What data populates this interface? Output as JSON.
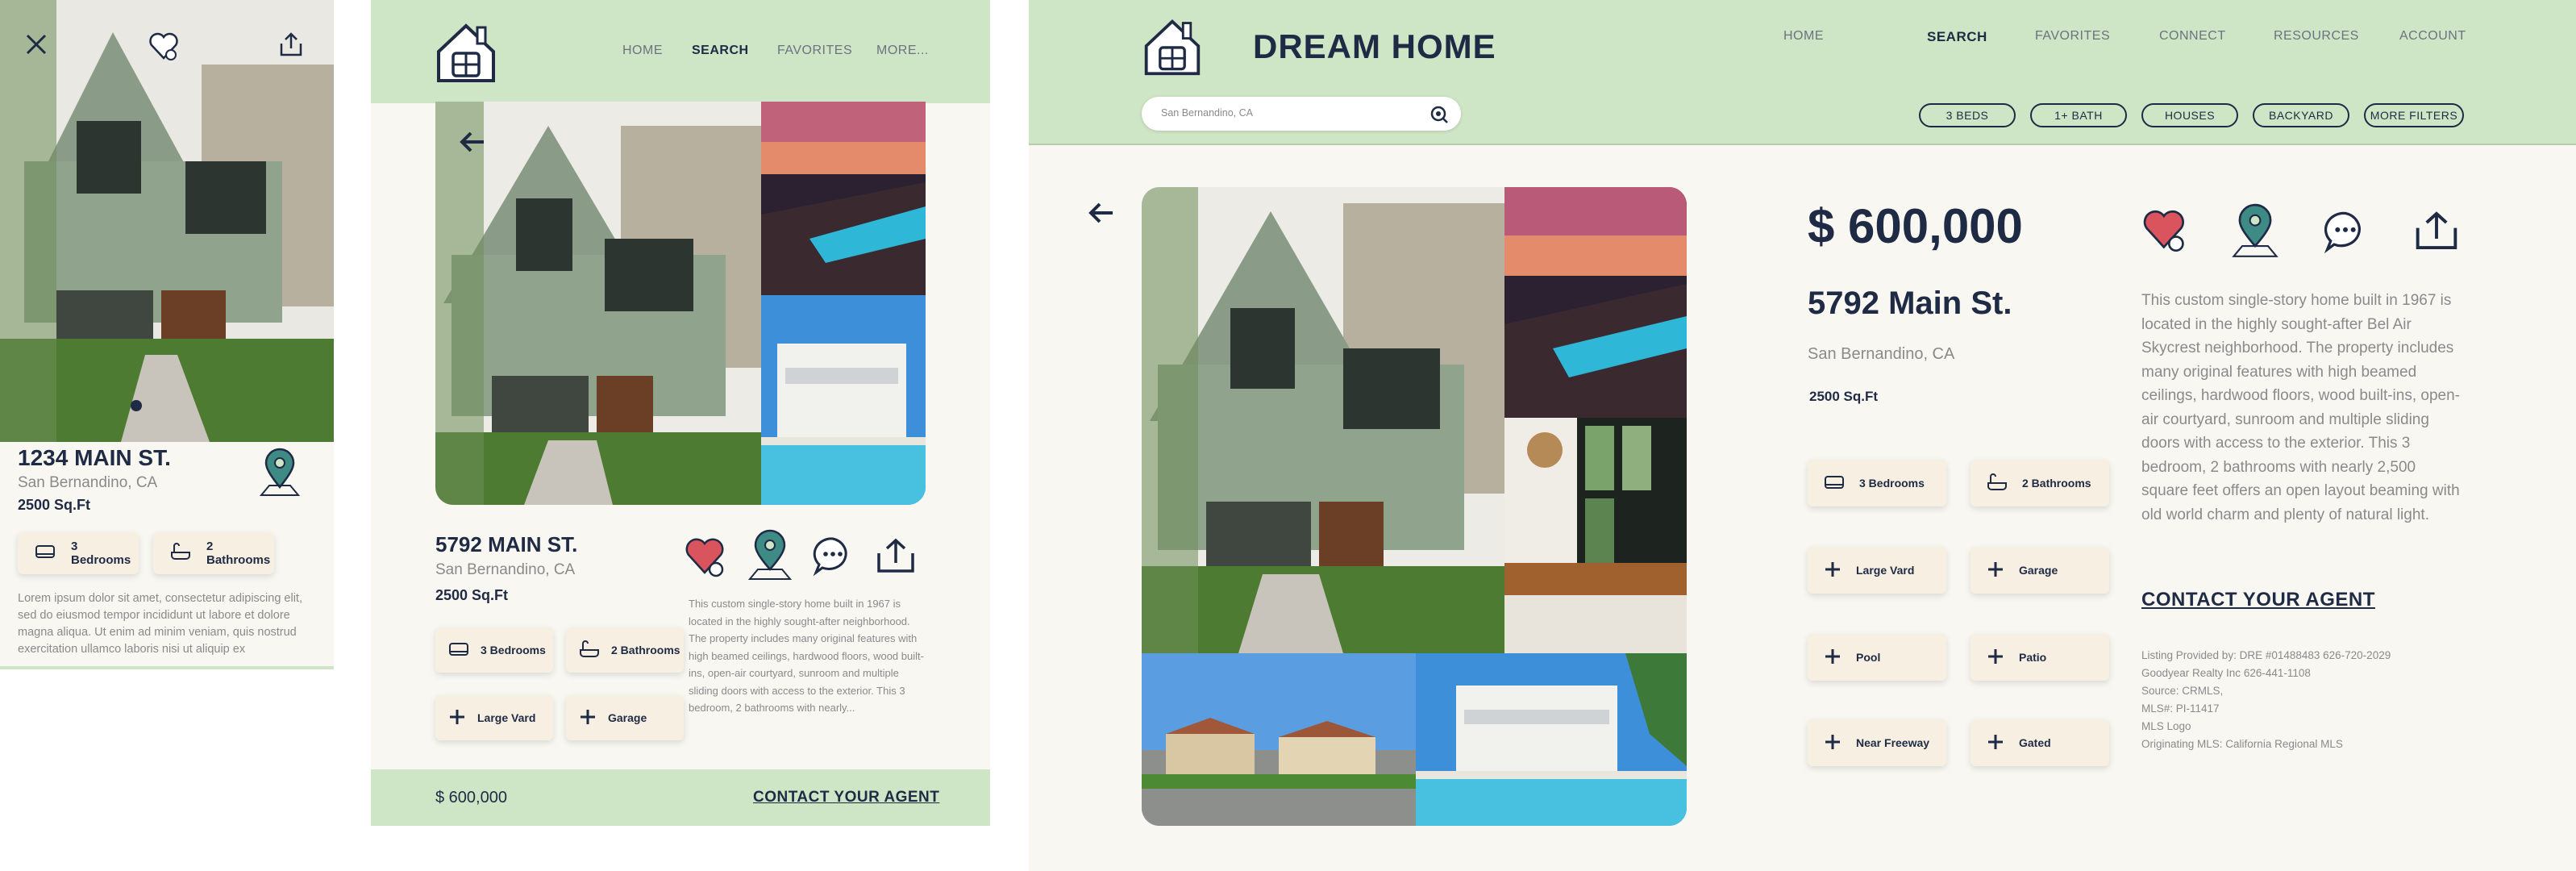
{
  "mobile": {
    "title": "1234 MAIN ST.",
    "city": "San Bernandino, CA",
    "sqft": "2500 Sq.Ft",
    "features": [
      "3 Bedrooms",
      "2 Bathrooms"
    ],
    "description": "Lorem ipsum dolor sit amet, consectetur adipiscing elit, sed do eiusmod tempor incididunt ut labore et dolore magna aliqua. Ut enim ad minim veniam, quis nostrud exercitation ullamco laboris nisi ut aliquip ex"
  },
  "tablet": {
    "nav": [
      "HOME",
      "SEARCH",
      "FAVORITES",
      "MORE..."
    ],
    "title": "5792 MAIN ST.",
    "city": "San Bernandino, CA",
    "sqft": "2500 Sq.Ft",
    "features": [
      "3 Bedrooms",
      "2 Bathrooms",
      "Large Vard",
      "Garage"
    ],
    "description": "This custom single-story home built in 1967 is located in the highly sought-after neighborhood. The property includes many original features with high beamed ceilings, hardwood floors, wood built-ins, open-air courtyard, sunroom and multiple sliding doors with access to the exterior. This 3 bedroom, 2 bathrooms with nearly...",
    "price": "$ 600,000",
    "contact": "CONTACT YOUR AGENT"
  },
  "desktop": {
    "brand": "DREAM HOME",
    "nav": [
      "HOME",
      "SEARCH",
      "FAVORITES",
      "CONNECT",
      "RESOURCES",
      "ACCOUNT"
    ],
    "search_value": "San Bernandino, CA",
    "filters": [
      "3 BEDS",
      "1+ BATH",
      "HOUSES",
      "BACKYARD",
      "MORE FILTERS"
    ],
    "price": "$ 600,000",
    "address": "5792 Main St.",
    "city": "San Bernandino, CA",
    "sqft": "2500 Sq.Ft",
    "features": [
      "3 Bedrooms",
      "2 Bathrooms",
      "Large Vard",
      "Garage",
      "Pool",
      "Patio",
      "Near Freeway",
      "Gated"
    ],
    "description": "This custom single-story home built in 1967 is located in the highly sought-after Bel Air Skycrest neighborhood. The property includes many original features with high beamed ceilings, hardwood floors, wood built-ins, open-air courtyard, sunroom and multiple sliding doors with access to the exterior. This 3 bedroom, 2 bathrooms with nearly 2,500 square feet offers an open layout beaming with old world charm and plenty of natural light.",
    "contact": "CONTACT YOUR AGENT",
    "listing_lines": [
      "Listing Provided by:  DRE #01488483 626-720-2029",
      "Goodyear Realty Inc 626-441-1108",
      "Source: CRMLS,",
      "MLS#: PI-11417",
      "MLS Logo",
      "Originating MLS: California Regional MLS"
    ]
  },
  "colors": {
    "header_green": "#cfe6c6",
    "navy": "#1f2a44",
    "cream": "#f6efe2",
    "bg": "#f8f7f2",
    "heart": "#d9545c"
  }
}
